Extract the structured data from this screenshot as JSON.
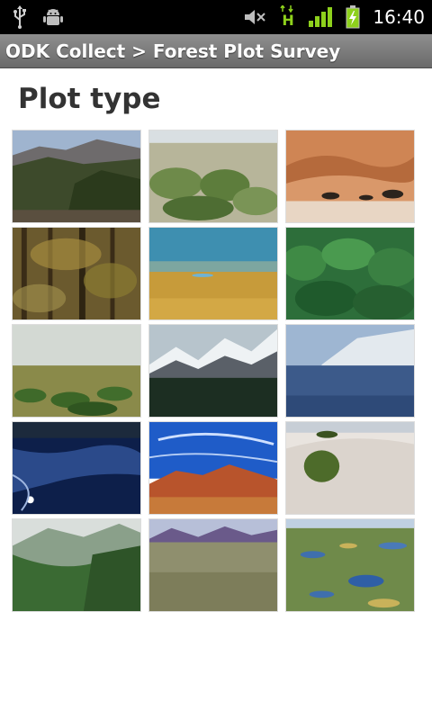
{
  "status_bar": {
    "time": "16:40",
    "network_label": "H",
    "icons": [
      "usb-icon",
      "android-debug-icon",
      "volume-muted-icon",
      "hspa-data-icon",
      "signal-strength-icon",
      "battery-charging-icon"
    ]
  },
  "title_bar": {
    "title": "ODK Collect > Forest Plot Survey"
  },
  "question": {
    "label": "Plot type"
  },
  "choices": [
    {
      "scene": "mountain-forest-valley"
    },
    {
      "scene": "green-shrubland"
    },
    {
      "scene": "desert-dunes-acacia"
    },
    {
      "scene": "deciduous-forest"
    },
    {
      "scene": "golden-grassland-lake"
    },
    {
      "scene": "dense-tropical-canopy"
    },
    {
      "scene": "savanna-scrub"
    },
    {
      "scene": "snowy-mountains-conifer"
    },
    {
      "scene": "frozen-marsh-cliffs"
    },
    {
      "scene": "dark-ocean-shore"
    },
    {
      "scene": "red-desert-mountains-blue-sky"
    },
    {
      "scene": "white-sand-dune-bush"
    },
    {
      "scene": "misty-green-hills"
    },
    {
      "scene": "grassland-purple-mountains"
    },
    {
      "scene": "wetland-tundra-pools"
    }
  ],
  "colors": {
    "status_bar_bg": "#000000",
    "title_bar_bg": "#7d7d7d",
    "question_text": "#333333",
    "signal_green": "#8ed11c"
  }
}
